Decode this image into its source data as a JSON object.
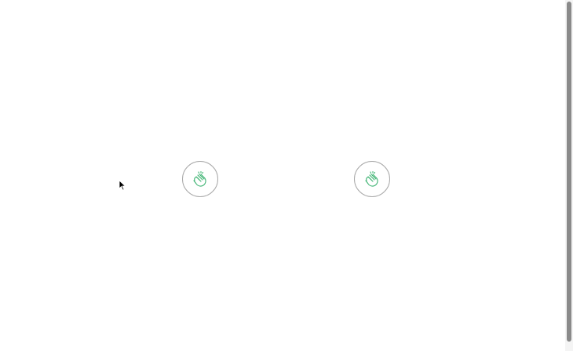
{
  "page": {
    "background": "#ffffff"
  },
  "clap_buttons": [
    {
      "icon": "clap-hands-icon",
      "accent_color": "#3cb371",
      "border_color": "#a8a8a8"
    },
    {
      "icon": "clap-hands-icon",
      "accent_color": "#3cb371",
      "border_color": "#a8a8a8"
    }
  ],
  "cursor": {
    "icon": "mouse-pointer-icon"
  },
  "scrollbar": {
    "thumb_color": "#8a8a8a",
    "track_color": "#f4f4f4"
  }
}
